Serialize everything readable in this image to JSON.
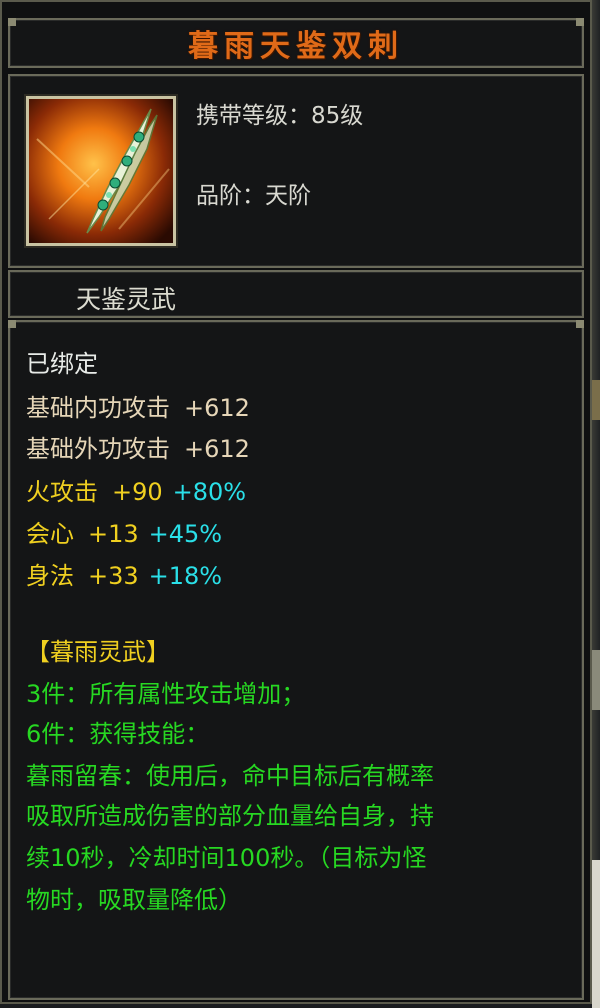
{
  "item": {
    "name": "暮雨天鉴双刺",
    "carry_level": "携带等级：85级",
    "grade": "品阶：天阶",
    "category": "天鉴灵武",
    "icon": "twin-daggers-weapon-icon"
  },
  "stats": {
    "bound": "已绑定",
    "base_internal_label": "基础内功攻击",
    "base_internal_value": "+612",
    "base_external_label": "基础外功攻击",
    "base_external_value": "+612",
    "fire_label": "火攻击",
    "fire_flat": "+90",
    "fire_pct": "+80%",
    "crit_label": "会心",
    "crit_flat": "+13",
    "crit_pct": "+45%",
    "agility_label": "身法",
    "agility_flat": "+33",
    "agility_pct": "+18%"
  },
  "set": {
    "name": "【暮雨灵武】",
    "bonus_3": "3件：所有属性攻击增加；",
    "bonus_6": "6件：获得技能：",
    "skill_line_1": "暮雨留春：使用后，命中目标后有概率",
    "skill_line_2": "吸取所造成伤害的部分血量给自身，持",
    "skill_line_3": "续10秒，冷却时间100秒。（目标为怪",
    "skill_line_4": "物时，吸取量降低）"
  },
  "colors": {
    "title": "#e06a18",
    "set_name": "#f0d020",
    "set_text": "#27d822",
    "percent": "#2ae0e8"
  }
}
